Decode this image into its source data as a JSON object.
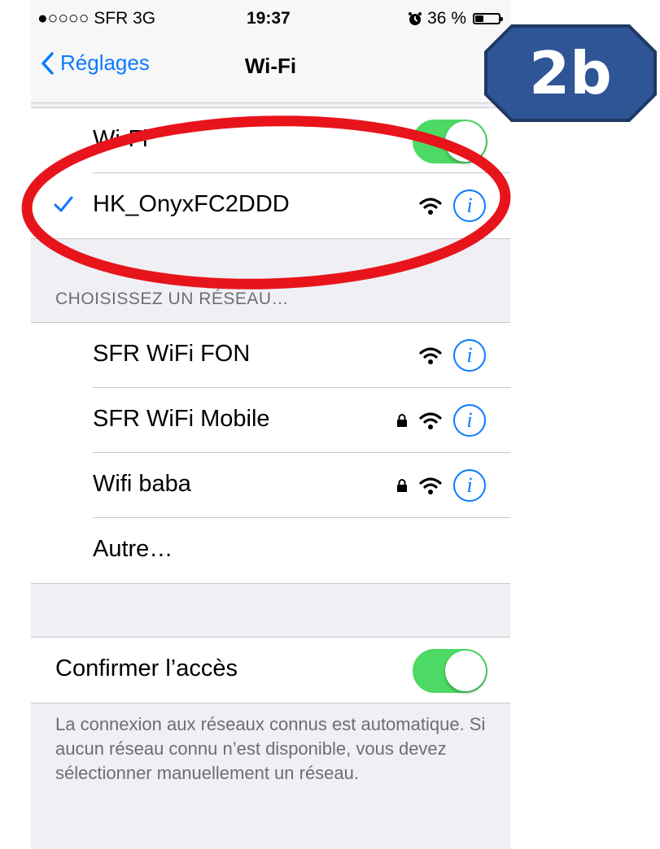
{
  "status_bar": {
    "carrier": "●○○○○ SFR  3G",
    "time": "19:37",
    "battery": "36 %",
    "battery_level": 0.36
  },
  "nav": {
    "back_label": "Réglages",
    "title": "Wi-Fi"
  },
  "wifi_toggle": {
    "label": "Wi-Fi",
    "on": true
  },
  "connected_network": {
    "name": "HK_OnyxFC2DDD",
    "secured": false
  },
  "section_header": "CHOISISSEZ UN RÉSEAU…",
  "networks": [
    {
      "name": "SFR WiFi FON",
      "secured": false
    },
    {
      "name": "SFR WiFi Mobile",
      "secured": true
    },
    {
      "name": "Wifi baba",
      "secured": true
    }
  ],
  "other_network": "Autre…",
  "confirm_access": {
    "label": "Confirmer l’accès",
    "on": true
  },
  "footer": "La connexion aux réseaux connus est automatique. Si aucun réseau connu n’est disponible, vous devez sélectionner manuellement un réseau.",
  "step_badge": "2b",
  "colors": {
    "accent": "#0a7aff",
    "toggle_on": "#4cd964",
    "annotation_red": "#e8141b",
    "badge_fill": "#2f5597"
  },
  "icons": {
    "back": "chevron-left-icon",
    "alarm": "alarm-clock-icon",
    "check": "checkmark-icon",
    "wifi": "wifi-signal-icon",
    "lock": "lock-icon",
    "info": "info-icon"
  }
}
